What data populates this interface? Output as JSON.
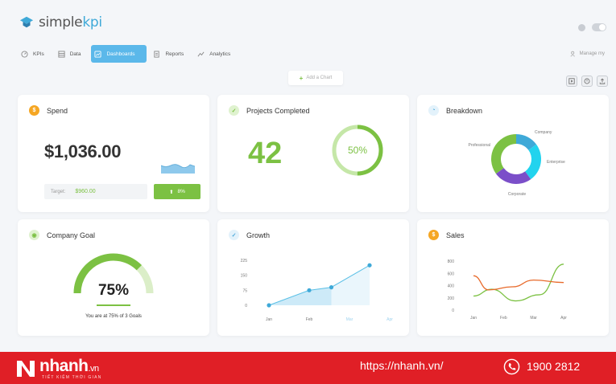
{
  "app": {
    "logo": {
      "part1": "simple",
      "part2": "kpi"
    },
    "nav": [
      {
        "label": "KPIs",
        "active": false
      },
      {
        "label": "Data",
        "active": false
      },
      {
        "label": "Dashboards",
        "active": true
      },
      {
        "label": "Reports",
        "active": false
      },
      {
        "label": "Analytics",
        "active": false
      }
    ],
    "manage_label": "Manage my",
    "add_chart_label": "Add a Chart",
    "colors": {
      "accent": "#5bb8ea",
      "green": "#7cc143",
      "orange": "#f5a623",
      "banner": "#e01f26"
    }
  },
  "cards": {
    "spend": {
      "title": "Spend",
      "value": "$1,036.00",
      "target_label": "Target:",
      "target_value": "$960.00",
      "change": "8%"
    },
    "projects": {
      "title": "Projects Completed",
      "value": "42",
      "percent_label": "50%",
      "percent": 50
    },
    "breakdown": {
      "title": "Breakdown"
    },
    "goal": {
      "title": "Company Goal",
      "value": "75%",
      "percent": 75,
      "caption": "You are at 75% of 3 Goals"
    },
    "growth": {
      "title": "Growth"
    },
    "sales": {
      "title": "Sales"
    }
  },
  "chart_data": [
    {
      "type": "pie",
      "labels": [
        "Company",
        "Enterprise",
        "Corporate",
        "Professional"
      ],
      "values": [
        15,
        25,
        25,
        35
      ],
      "colors": [
        "#3fa9d8",
        "#22d3ee",
        "#7b4fc9",
        "#7cc143"
      ]
    },
    {
      "type": "area",
      "categories": [
        "Jan",
        "Feb",
        "Mar",
        "Apr"
      ],
      "x": [
        0,
        1,
        1.55,
        2.5
      ],
      "values": [
        0,
        75,
        90,
        200
      ],
      "yticks": [
        "225",
        "150",
        "75",
        "0"
      ],
      "ylim": [
        0,
        225
      ]
    },
    {
      "type": "line",
      "categories": [
        "Jan",
        "Feb",
        "Mar",
        "Apr"
      ],
      "yticks": [
        "800",
        "600",
        "400",
        "200",
        "0"
      ],
      "ylim": [
        0,
        800
      ],
      "series": [
        {
          "color": "#7cc143",
          "x": [
            0,
            0.6,
            1.4,
            2.2,
            3.0
          ],
          "values": [
            230,
            340,
            150,
            250,
            750
          ]
        },
        {
          "color": "#e86a2b",
          "x": [
            0,
            0.5,
            1.3,
            2.0,
            3.0
          ],
          "values": [
            560,
            330,
            380,
            490,
            450
          ]
        }
      ]
    }
  ],
  "banner": {
    "brand": "nhanh",
    "brand_tld": ".vn",
    "slogan": "TIẾT KIỆM THỜI GIAN",
    "url": "https://nhanh.vn/",
    "phone": "1900 2812"
  }
}
